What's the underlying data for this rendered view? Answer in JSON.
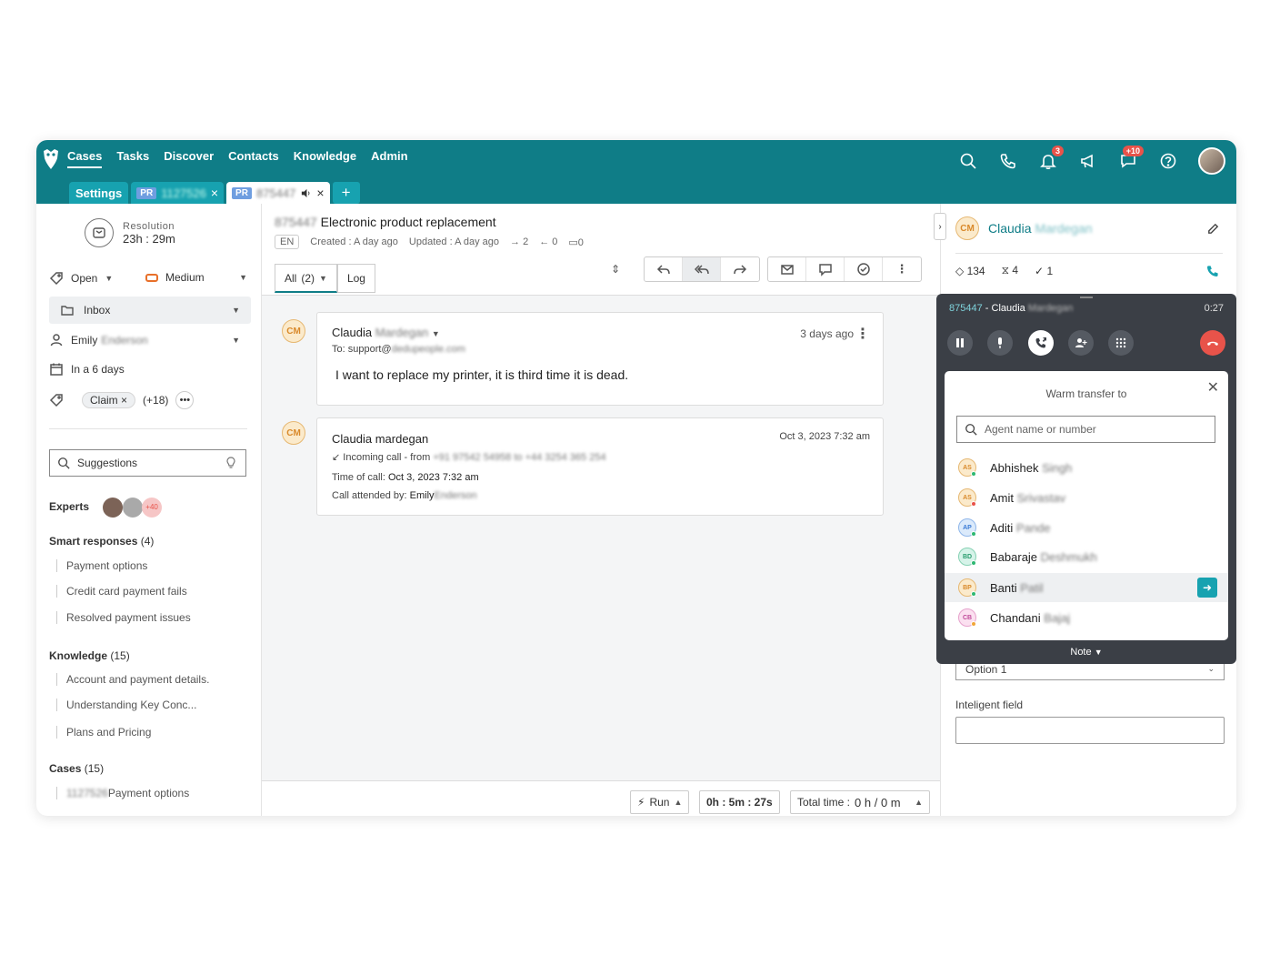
{
  "nav": {
    "items": [
      "Cases",
      "Tasks",
      "Discover",
      "Contacts",
      "Knowledge",
      "Admin"
    ],
    "badges": {
      "notifications": "3",
      "chat": "+10"
    }
  },
  "tabs": {
    "settings": "Settings",
    "pr_label": "PR",
    "tab1_id": "1127526",
    "tab2_id": "875447",
    "close": "×",
    "add": "+"
  },
  "left": {
    "resolution_label": "Resolution",
    "resolution_value": "23h : 29m",
    "status": "Open",
    "priority": "Medium",
    "queue": "Inbox",
    "assignee_first": "Emily",
    "assignee_last": "Enderson",
    "due": "In a 6 days",
    "tag": "Claim",
    "tag_more": "(+18)",
    "suggestions_placeholder": "Suggestions",
    "experts_label": "Experts",
    "expert_more": "+40",
    "smart_label": "Smart responses",
    "smart_count": "(4)",
    "smart_items": [
      "Payment options",
      "Credit card payment fails",
      "Resolved payment issues"
    ],
    "knowledge_label": "Knowledge",
    "knowledge_count": "(15)",
    "knowledge_items": [
      "Account and payment details.",
      "Understanding Key Conc...",
      "Plans and Pricing"
    ],
    "cases_label": "Cases",
    "cases_count": "(15)",
    "case_id": "1127526",
    "case_item": "Payment options"
  },
  "case": {
    "id": "875447",
    "title": "Electronic product replacement",
    "lang": "EN",
    "created": "Created : A day ago",
    "updated": "Updated : A day ago",
    "out_count": "2",
    "in_count": "0",
    "comments": "0",
    "tab_all": "All",
    "tab_all_count": "(2)",
    "tab_log": "Log"
  },
  "messages": [
    {
      "initials": "CM",
      "sender_first": "Claudia",
      "sender_last": "Mardegan",
      "to_label": "To: support@",
      "to_domain": "dedupeople.com",
      "time": "3 days ago",
      "body": "I want to replace my printer, it is third time it is dead."
    },
    {
      "initials": "CM",
      "sender": "Claudia mardegan",
      "time": "Oct 3, 2023 7:32 am",
      "call_label": "Incoming call -",
      "from_label": "from",
      "from_number": "+91 97542 54958 to +44 3254 365 254",
      "time_of_call_label": "Time of call:",
      "time_of_call": "Oct 3, 2023 7:32 am",
      "attended_label": "Call attended by:",
      "attended_first": "Emily",
      "attended_last": "Enderson"
    }
  ],
  "footer": {
    "run": "Run",
    "timer": "0h : 5m : 27s",
    "total_label": "Total time :",
    "total_value": "0 h / 0 m"
  },
  "right": {
    "initials": "CM",
    "name_first": "Claudia",
    "name_last": "Mardegan",
    "stat_tags": "134",
    "stat_pending": "4",
    "stat_done": "1",
    "dropdown_value": "Option 1",
    "intelligent_label": "Inteligent field"
  },
  "call": {
    "header_id": "875447",
    "header_name": "- Claudia",
    "header_last": "Mardegan",
    "timer": "0:27",
    "transfer_title": "Warm transfer to",
    "search_placeholder": "Agent name or number",
    "agents": [
      {
        "initials": "AS",
        "first": "Abhishek",
        "last": "Singh",
        "bg": "#fbeacb",
        "fg": "#d9892a",
        "status": "#2eb872"
      },
      {
        "initials": "AS",
        "first": "Amit",
        "last": "Srivastav",
        "bg": "#fbeacb",
        "fg": "#d9892a",
        "status": "#e8534a"
      },
      {
        "initials": "AP",
        "first": "Aditi",
        "last": "Pande",
        "bg": "#dbeafb",
        "fg": "#3a7bd5",
        "status": "#2eb872"
      },
      {
        "initials": "BD",
        "first": "Babaraje",
        "last": "Deshmukh",
        "bg": "#d6f3e9",
        "fg": "#2a9d6f",
        "status": "#2eb872"
      },
      {
        "initials": "BP",
        "first": "Banti",
        "last": "Patil",
        "bg": "#fbeacb",
        "fg": "#d9892a",
        "status": "#2eb872"
      },
      {
        "initials": "CB",
        "first": "Chandani",
        "last": "Bajaj",
        "bg": "#fbe0f0",
        "fg": "#c04a9a",
        "status": "#f0a63a"
      }
    ],
    "note": "Note"
  },
  "colors": {
    "brand": "#0f7d87",
    "tab": "#17a2b0",
    "danger": "#e8534a"
  }
}
